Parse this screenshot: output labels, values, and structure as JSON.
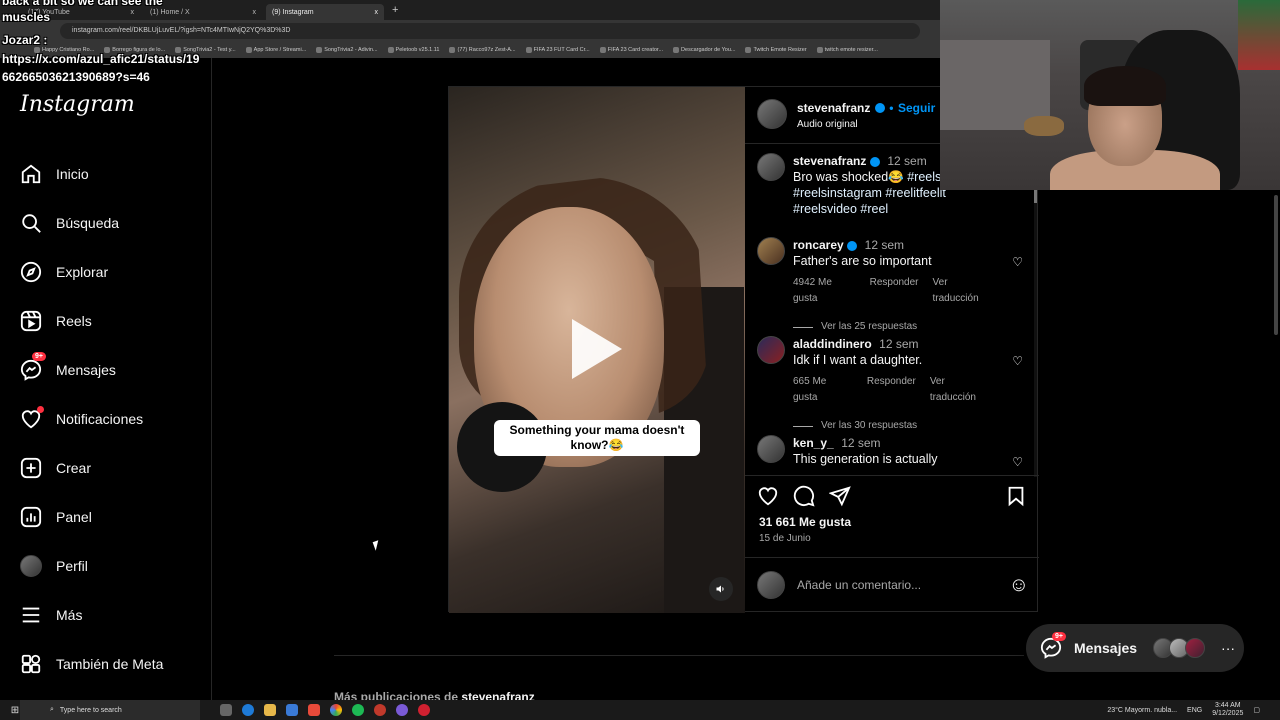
{
  "browser": {
    "tabs": [
      {
        "label": "(17) YouTube",
        "close": "x"
      },
      {
        "label": "(1) Home / X",
        "close": "x"
      },
      {
        "label": "(9) Instagram",
        "close": "x"
      }
    ],
    "new_tab": "+",
    "url": "instagram.com/reel/DKBLUjLuvEL/?igsh=NTc4MTIwNjQ2YQ%3D%3D",
    "bookmarks": [
      "Happy Cristiano Ro...",
      "Borrego figura de lo...",
      "SongTrivia2 - Test y...",
      "App Store / Streami...",
      "SongTrivia2 - Adivin...",
      "Peletoob v25.1.11",
      "(77) Racco97z Zest-A...",
      "FIFA 23 FUT Card Cr...",
      "FIFA 23 Card creator...",
      "Descargador de You...",
      "Twitch Emote Resizer",
      "twitch emote resizer..."
    ]
  },
  "chat_overlay": {
    "line1": "back a bit so we can see the",
    "line2": "muscles",
    "user": "Jozar2 :",
    "link1": "https://x.com/azul_afic21/status/19",
    "link2": "66266503621390689?s=46"
  },
  "sidebar": {
    "logo": "Instagram",
    "items": [
      {
        "label": "Inicio"
      },
      {
        "label": "Búsqueda"
      },
      {
        "label": "Explorar"
      },
      {
        "label": "Reels"
      },
      {
        "label": "Mensajes",
        "badge": "9+"
      },
      {
        "label": "Notificaciones"
      },
      {
        "label": "Crear"
      },
      {
        "label": "Panel"
      },
      {
        "label": "Perfil"
      },
      {
        "label": "Más"
      },
      {
        "label": "También de Meta"
      }
    ]
  },
  "post": {
    "video_caption": "Something your mama doesn't know?😂",
    "header": {
      "username": "stevenafranz",
      "separator": "•",
      "follow": "Seguir",
      "audio": "Audio original"
    },
    "caption": {
      "username": "stevenafranz",
      "time": "12 sem",
      "text": "Bro was shocked😂",
      "hashtags": "#reels #reelsinstagram #reelitfeelit #reelsvideo #reel"
    },
    "comments": [
      {
        "username": "roncarey",
        "verified": true,
        "time": "12 sem",
        "text": "Father's are so important",
        "likes": "4942 Me gusta",
        "reply": "Responder",
        "translate": "Ver traducción",
        "replies": "Ver las 25 respuestas"
      },
      {
        "username": "aladdindinero",
        "verified": false,
        "time": "12 sem",
        "text": "Idk if I want a daughter.",
        "likes": "665 Me gusta",
        "reply": "Responder",
        "translate": "Ver traducción",
        "replies": "Ver las 30 respuestas"
      },
      {
        "username": "ken_y_",
        "verified": false,
        "time": "12 sem",
        "text": "This generation is actually"
      }
    ],
    "likes": "31 661 Me gusta",
    "date": "15 de Junio",
    "add_comment_placeholder": "Añade un comentario...",
    "emoji": "☺"
  },
  "messages_pill": {
    "label": "Mensajes",
    "badge": "9+",
    "more": "···"
  },
  "more_posts": {
    "prefix": "Más publicaciones de",
    "username": "stevenafranz"
  },
  "taskbar": {
    "search": "Type here to search",
    "weather": "23°C  Mayorm. nubla...",
    "lang": "ENG",
    "time": "3:44 AM",
    "date": "9/12/2025"
  },
  "colors": {
    "accent": "#0095f6",
    "badge": "#ff3040",
    "bg": "#000000",
    "border": "#262626",
    "muted": "#a8a8a8"
  }
}
